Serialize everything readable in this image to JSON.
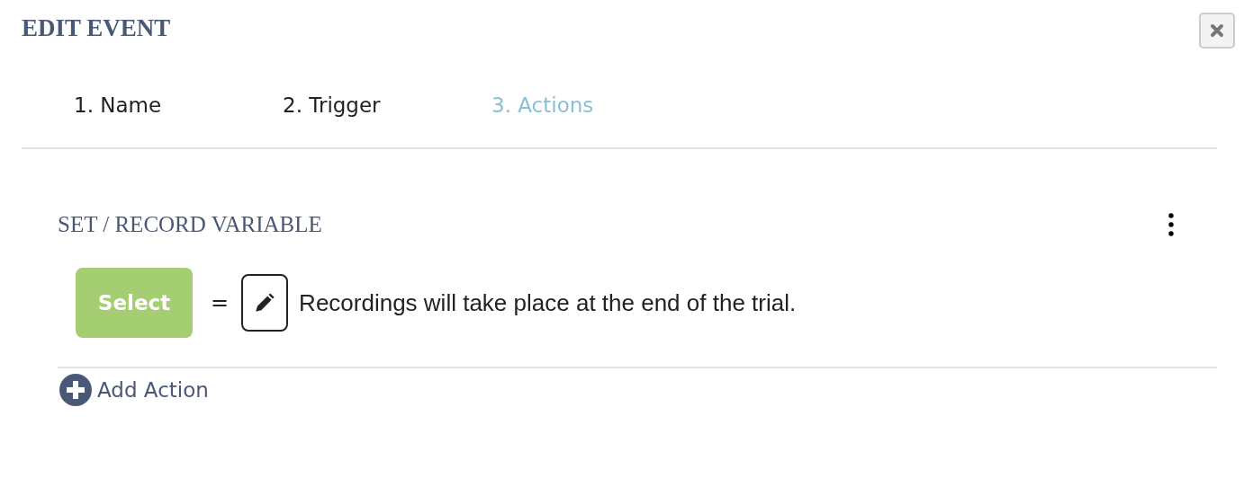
{
  "dialog": {
    "title": "EDIT EVENT"
  },
  "steps": [
    {
      "label": "1. Name",
      "selected": false
    },
    {
      "label": "2. Trigger",
      "selected": false
    },
    {
      "label": "3. Actions",
      "selected": true
    }
  ],
  "action": {
    "title": "SET / RECORD VARIABLE",
    "variable_button": "Select",
    "operator": "=",
    "value_text": "Recordings will take place at the end of the trial."
  },
  "add_action": "Add Action"
}
